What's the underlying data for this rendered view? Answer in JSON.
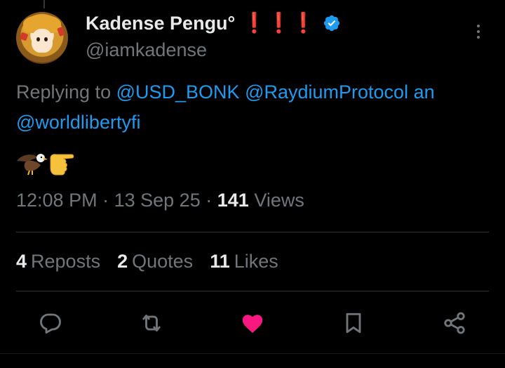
{
  "tweet": {
    "author": {
      "display_name": "Kadense Pengu°",
      "name_emojis": "❗❗❗",
      "handle": "@iamkadense",
      "verified": true
    },
    "replying": {
      "prefix": "Replying to",
      "mentions": [
        "@USD_BONK",
        "@RaydiumProtocol",
        "an",
        "@worldlibertyfi"
      ]
    },
    "body_emojis": [
      "eagle",
      "backhand-index-pointing-right"
    ],
    "meta": {
      "time": "12:08 PM",
      "sep1": "·",
      "date": "13 Sep 25",
      "sep2": "·",
      "views_count": "141",
      "views_label": "Views"
    },
    "stats": [
      {
        "count": "4",
        "label": "Reposts"
      },
      {
        "count": "2",
        "label": "Quotes"
      },
      {
        "count": "11",
        "label": "Likes"
      }
    ],
    "actions": [
      "reply",
      "repost",
      "like",
      "bookmark",
      "share"
    ],
    "colors": {
      "background": "#000000",
      "text": "#e7e9ea",
      "muted": "#71767b",
      "link": "#1d9bf0",
      "like": "#f91880",
      "verified": "#1d9bf0",
      "alert": "#e0242f"
    }
  }
}
